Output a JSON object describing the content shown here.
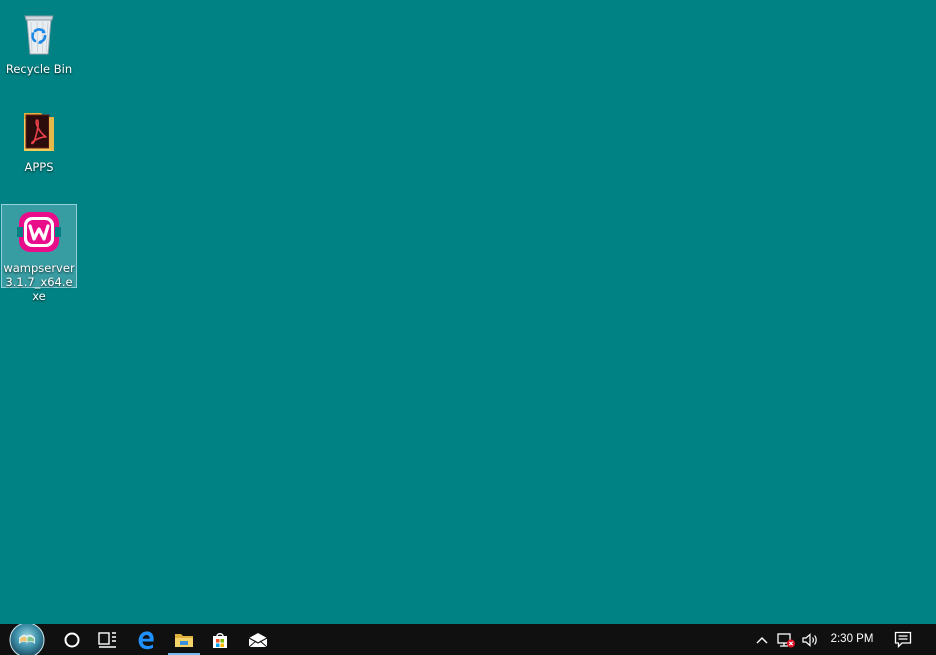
{
  "desktop": {
    "background_color": "#008284",
    "icons": [
      {
        "label": "Recycle Bin",
        "icon": "recycle-bin-icon"
      },
      {
        "label": "APPS",
        "icon": "folder-pdf-icon"
      },
      {
        "label": "wampserver3.1.7_x64.exe",
        "icon": "wampserver-icon",
        "selected": true
      }
    ]
  },
  "taskbar": {
    "background_color": "#101010",
    "start_icon": "start-orb-icon",
    "pinned": [
      {
        "name": "Cortana",
        "icon": "cortana-circle-icon"
      },
      {
        "name": "Task View",
        "icon": "task-view-icon"
      },
      {
        "name": "Edge",
        "icon": "edge-icon"
      },
      {
        "name": "File Explorer",
        "icon": "file-explorer-icon",
        "active": true
      },
      {
        "name": "Store",
        "icon": "store-icon"
      },
      {
        "name": "Mail",
        "icon": "mail-icon"
      }
    ],
    "tray": {
      "icons": [
        "chevron-up-icon",
        "network-disconnected-icon",
        "volume-icon"
      ],
      "clock": "2:30 PM",
      "notification_icon": "action-center-icon"
    }
  }
}
